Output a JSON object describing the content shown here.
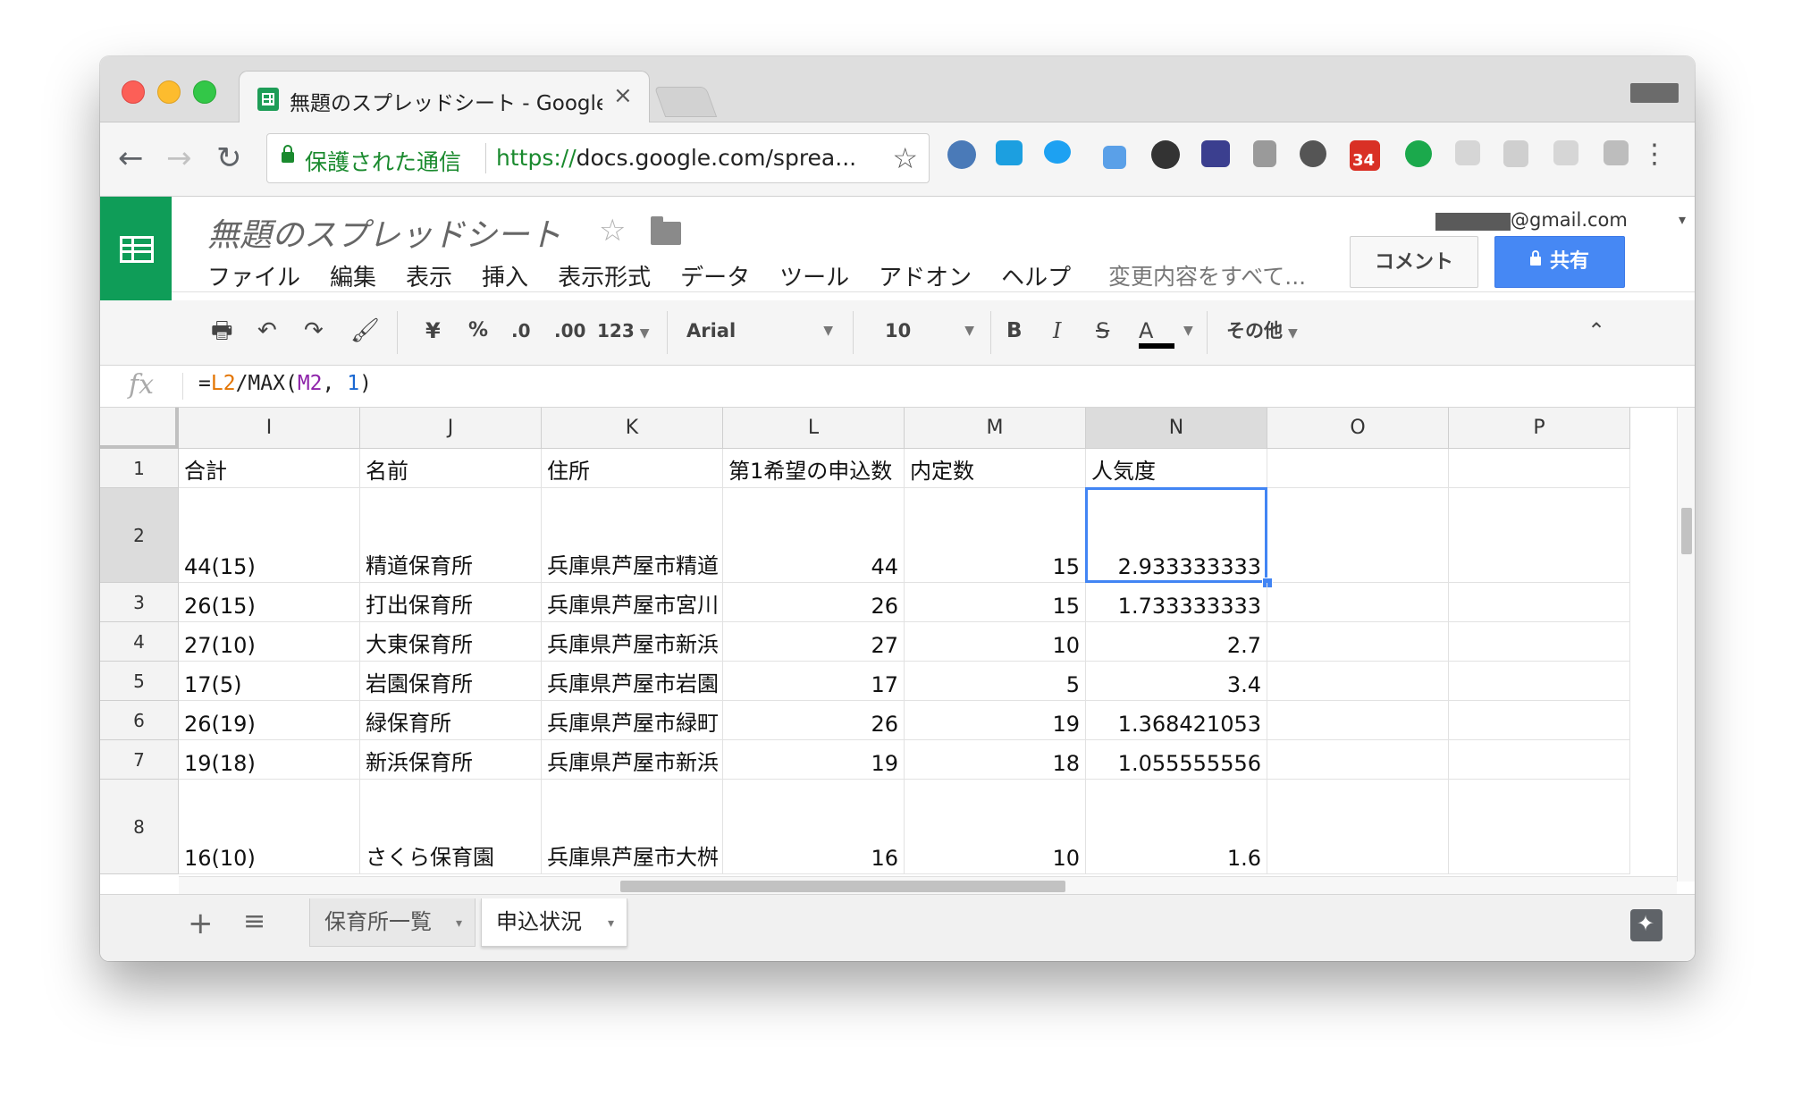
{
  "browser": {
    "tab_title": "無題のスプレッドシート - Google",
    "tab_close": "×",
    "nav_back": "←",
    "nav_forward": "→",
    "nav_reload": "↻",
    "secure_label": "保護された通信",
    "url_scheme": "https://",
    "url_rest": "docs.google.com/sprea...",
    "bookmark_star": "☆",
    "extension_badge": "34",
    "menu_dots": "⋮"
  },
  "sheets": {
    "doc_title": "無題のスプレッドシート",
    "doc_star": "☆",
    "menu": [
      "ファイル",
      "編集",
      "表示",
      "挿入",
      "表示形式",
      "データ",
      "ツール",
      "アドオン",
      "ヘルプ"
    ],
    "save_status": "変更内容をすべて...",
    "account_email": "@gmail.com",
    "account_caret": "▾",
    "comment_button": "コメント",
    "share_button": "共有"
  },
  "format_toolbar": {
    "print": "🖶",
    "undo": "↶",
    "redo": "↷",
    "paint_format": "🖌",
    "currency": "¥",
    "percent": "%",
    "decrease_decimal": ".0",
    "increase_decimal": ".00",
    "more_formats": "123",
    "font": "Arial",
    "font_size": "10",
    "bold": "B",
    "italic": "I",
    "strikethrough": "S",
    "text_color": "A",
    "more": "その他",
    "collapse": "⌃"
  },
  "formula_bar": {
    "fx_label": "fx",
    "formula_prefix": "=",
    "ref1": "L2",
    "mid": "/MAX(",
    "ref2": "M2",
    "sep": ", ",
    "num": "1",
    "suffix": ")"
  },
  "grid": {
    "columns": [
      "I",
      "J",
      "K",
      "L",
      "M",
      "N",
      "O",
      "P"
    ],
    "selected_column": "N",
    "selected_row": "2",
    "rows": [
      {
        "row": "1",
        "cells": [
          "合計",
          "名前",
          "住所",
          "第1希望の申込数",
          "内定数",
          "人気度",
          "",
          ""
        ]
      },
      {
        "row": "2",
        "cells": [
          "44(15)",
          "精道保育所",
          "兵庫県芦屋市精道",
          "44",
          "15",
          "2.933333333",
          "",
          ""
        ]
      },
      {
        "row": "3",
        "cells": [
          "26(15)",
          "打出保育所",
          "兵庫県芦屋市宮川",
          "26",
          "15",
          "1.733333333",
          "",
          ""
        ]
      },
      {
        "row": "4",
        "cells": [
          "27(10)",
          "大東保育所",
          "兵庫県芦屋市新浜",
          "27",
          "10",
          "2.7",
          "",
          ""
        ]
      },
      {
        "row": "5",
        "cells": [
          "17(5)",
          "岩園保育所",
          "兵庫県芦屋市岩園",
          "17",
          "5",
          "3.4",
          "",
          ""
        ]
      },
      {
        "row": "6",
        "cells": [
          "26(19)",
          "緑保育所",
          "兵庫県芦屋市緑町",
          "26",
          "19",
          "1.368421053",
          "",
          ""
        ]
      },
      {
        "row": "7",
        "cells": [
          "19(18)",
          "新浜保育所",
          "兵庫県芦屋市新浜",
          "19",
          "18",
          "1.055555556",
          "",
          ""
        ]
      },
      {
        "row": "8",
        "cells": [
          "16(10)",
          "さくら保育園",
          "兵庫県芦屋市大桝",
          "16",
          "10",
          "1.6",
          "",
          ""
        ]
      }
    ]
  },
  "sheet_tabs": {
    "add": "+",
    "list": "≡",
    "tabs": [
      {
        "label": "保育所一覧",
        "active": false
      },
      {
        "label": "申込状況",
        "active": true
      }
    ],
    "caret": "▾"
  }
}
